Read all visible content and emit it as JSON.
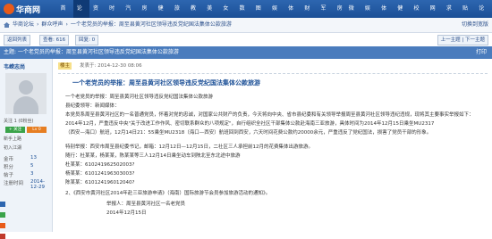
{
  "site": {
    "logo_text": "华商网",
    "nav": [
      "首页",
      "论坛",
      "资讯",
      "时尚",
      "汽车",
      "房产",
      "健康",
      "旅游",
      "教育",
      "美食",
      "女子",
      "数码",
      "图片",
      "娱乐",
      "体育",
      "财经",
      "军事",
      "房",
      "微博",
      "娱乐",
      "体育",
      "健康",
      "校园",
      "网购",
      "求子",
      "贴吧",
      "论坛"
    ]
  },
  "breadcrumb": {
    "items": [
      "华商论坛",
      "群众呼声",
      "一个老党员的举报：周至县黄河社区领导违反党纪国法集体公款旅游"
    ],
    "right": "切换到宽版"
  },
  "toolbar": {
    "return": "返回列表",
    "views": "查看: 616",
    "replies": "回复: 0",
    "prev": "上一主题",
    "next": "下一主题",
    "right": "切换到宽版"
  },
  "title_bar": {
    "text": "主题: 一个老党员的举报：周至县黄河社区领导违反党纪国法集体公款旅游",
    "right": "打印"
  },
  "author": {
    "name": "韦嵘志尚",
    "follow": "关注 1 (0粉丝)",
    "tag1": "+ 关注",
    "tag2": "Lv 0",
    "level_text": "新手上路",
    "badge": "初入江湖",
    "stats": [
      {
        "label": "金币",
        "value": "13"
      },
      {
        "label": "积分",
        "value": "5"
      },
      {
        "label": "帖子",
        "value": "3"
      },
      {
        "label": "注册时间",
        "value": "2014-12-29"
      }
    ]
  },
  "post": {
    "tag": "楼主",
    "time": "发表于: 2014-12-30 08:06",
    "title": "一个老党员的举报：周至县黄河社区领导违反党纪国法集体公款旅游",
    "lines": [
      "一个老党员的举报：周至县黄河社区领导违反党纪国法集体公款旅游",
      "县纪委领导：新闻媒体：",
      "本党员系周至县黄河社区的一名普通党员，怀着对党的忠诚，对国家公共财产的负责，今天将向中央、省市县纪委和有关领导举报周至县黄河社区领导违纪违规，现将其主要事实举报如下：",
      "2014年12月，严重违反中央\"关于改进工作作风、密切联系群众的八项规定\"，自行组织全社区干部集体公款赴海南三亚旅游，具体时间为2014年12月15日乘坐MU2317",
      "（西安—海口）航班，12月14日21：55乘坐MU2318（海口—西安）航班回到西安，六天时间花费公款约20000余元，严重违反了党纪国法，损害了党员干部的形象。",
      "特别举报：西安市周至县纪委书记，邮箱：12月12日—12月15日，二社区三人承担前12月的花费集体出游旅游。",
      "随行：杜某某，杨某某，陈某某等三人12月14日乘坐动车到陕北至东北途中旅游",
      "杜某某：610241962502003?",
      "杨某某：610124196303003?",
      "陈某某：610124196012040?",
      "2、《西安市黄河社区2014年赴三亚旅游申请》（海南）国际旅游节会员参加旅游活动的通知》。"
    ],
    "closing": [
      "举报人：周至县黄河社区一名老党员",
      "2014年12月15日"
    ]
  }
}
